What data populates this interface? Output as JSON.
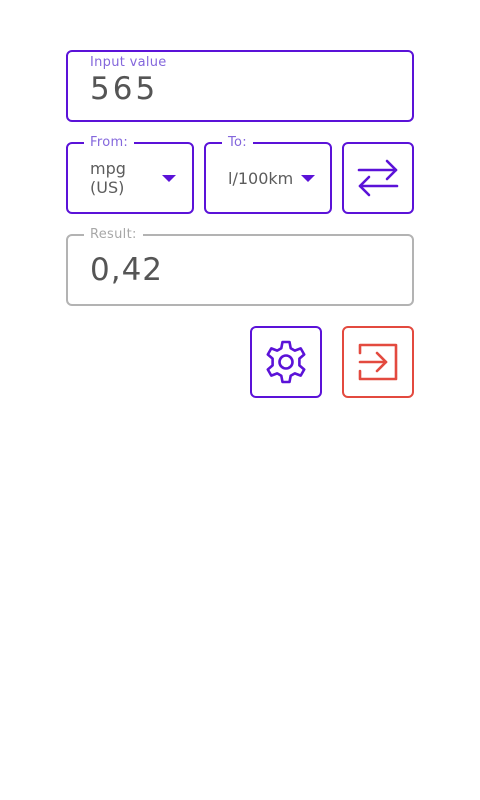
{
  "input": {
    "label": "Input value",
    "value": "565"
  },
  "from": {
    "label": "From:",
    "selected": "mpg (US)"
  },
  "to": {
    "label": "To:",
    "selected": "l/100km"
  },
  "result": {
    "label": "Result:",
    "value": "0,42"
  },
  "icons": {
    "swap": "swap-arrows-icon",
    "settings": "gear-icon",
    "exit": "exit-icon",
    "dropdown": "caret-down-icon"
  },
  "colors": {
    "accent": "#5b12d8",
    "label": "#8467dc",
    "disabled_border": "#b3b3b3",
    "exit": "#e34a3f",
    "text": "#555555"
  }
}
